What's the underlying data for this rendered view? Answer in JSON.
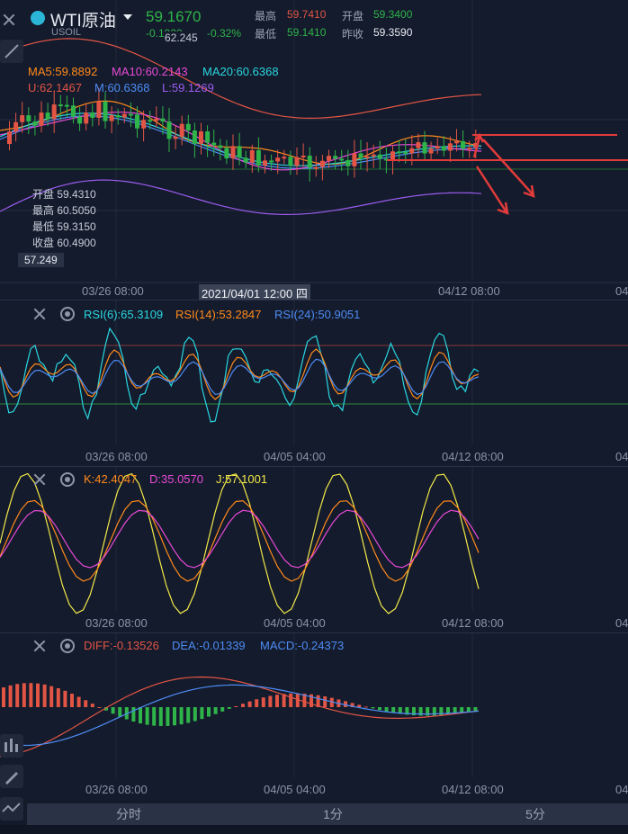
{
  "header": {
    "symbol_name": "WTI原油",
    "symbol_code": "USOIL",
    "last_price": "59.1670",
    "change": "-0.1920",
    "change_pct": "-0.32%",
    "high_label": "最高",
    "high_value": "59.7410",
    "open_label": "开盘",
    "open_value": "59.3400",
    "low_label": "最低",
    "low_value": "59.1410",
    "prev_close_label": "昨收",
    "prev_close_value": "59.3590",
    "price_level_label": "62.245"
  },
  "main_chart": {
    "ma5": "MA5:59.8892",
    "ma10": "MA10:60.2143",
    "ma20": "MA20:60.6368",
    "boll_u": "U:62.1467",
    "boll_m": "M:60.6368",
    "boll_l": "L:59.1269",
    "ohlc_open": "开盘 59.4310",
    "ohlc_high": "最高 60.5050",
    "ohlc_low": "最低 59.3150",
    "ohlc_close": "收盘 60.4900",
    "low_price_tag": "57.249",
    "x_labels": [
      "03/26 08:00",
      "2021/04/01 12:00 四",
      "04/12 08:00",
      "04"
    ]
  },
  "rsi_panel": {
    "rsi6": "RSI(6):65.3109",
    "rsi14": "RSI(14):53.2847",
    "rsi24": "RSI(24):50.9051",
    "x_labels": [
      "03/26 08:00",
      "04/05 04:00",
      "04/12 08:00",
      "04"
    ]
  },
  "kdj_panel": {
    "k": "K:42.4047",
    "d": "D:35.0570",
    "j": "J:57.1001",
    "x_labels": [
      "03/26 08:00",
      "04/05 04:00",
      "04/12 08:00",
      "04"
    ]
  },
  "macd_panel": {
    "diff": "DIFF:-0.13526",
    "dea": "DEA:-0.01339",
    "macd": "MACD:-0.24373",
    "x_labels": [
      "03/26 08:00",
      "04/05 04:00",
      "04/12 08:00",
      "04"
    ]
  },
  "tabs": [
    "分时",
    "1分",
    "5分"
  ],
  "colors": {
    "up": "#e25545",
    "down": "#2fb44a",
    "ma5": "#ff8a1c",
    "ma10": "#e84ad8",
    "ma20": "#2ad6e0",
    "boll_u": "#e25545",
    "boll_m": "#4d8cf5",
    "boll_l": "#9c5cf0",
    "kdj_k": "#ff8a1c",
    "kdj_d": "#e84ad8",
    "kdj_j": "#f2e84a",
    "rsi6": "#2ad6e0",
    "rsi14": "#ff8a1c",
    "rsi24": "#4d8cf5"
  }
}
